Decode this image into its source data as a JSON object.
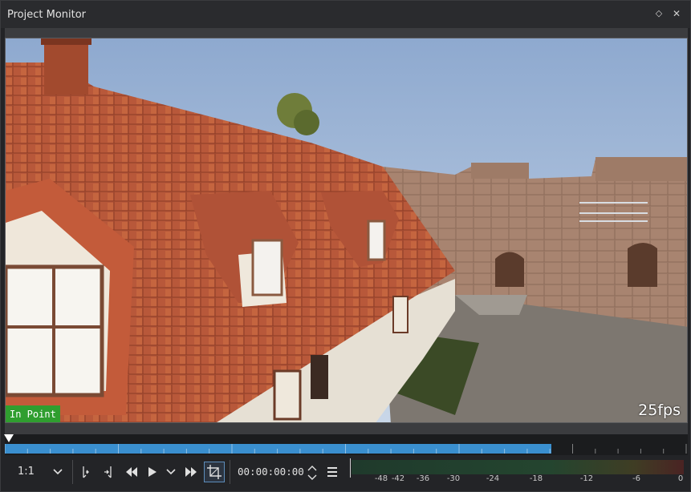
{
  "window": {
    "title": "Project Monitor"
  },
  "titlebar": {
    "float_icon": "diamond-icon",
    "close_icon": "close-icon"
  },
  "video": {
    "fps_label": "25fps",
    "in_point_label": "In Point"
  },
  "ruler": {
    "progress": 0.8
  },
  "toolbar": {
    "zoom": "1:1",
    "icons": [
      "chevron-down-icon",
      "set-in-icon",
      "set-out-icon",
      "rewind-icon",
      "play-icon",
      "play-options-icon",
      "fast-forward-icon",
      "crop-icon",
      "spin-icon",
      "menu-icon"
    ],
    "timecode": "00:00:00:00"
  },
  "audio_meter": {
    "labels": [
      "-48",
      "-42",
      "-36",
      "-30",
      "-24",
      "-18",
      "-12",
      "-6",
      "0"
    ]
  },
  "colors": {
    "accent": "#3a8fcf",
    "in_point": "#2f9e2f"
  }
}
